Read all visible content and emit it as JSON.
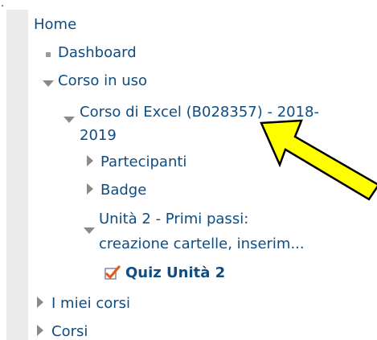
{
  "stray_mark": ".",
  "nav": {
    "home": "Home",
    "dashboard": "Dashboard",
    "current_course_section": "Corso in uso",
    "course_line1": "Corso di Excel (B028357) - 2018-",
    "course_line2": "2019",
    "participants": "Partecipanti",
    "badges": "Badge",
    "unit_line1": "Unità 2 - Primi passi:",
    "unit_line2": "creazione cartelle, inserim...",
    "quiz": "Quiz Unità 2",
    "my_courses": "I miei corsi",
    "courses": "Corsi"
  },
  "colors": {
    "link": "#0f4c81",
    "panel_border": "#ebebeb",
    "arrow_fill": "#ffff00",
    "arrow_stroke": "#000000"
  },
  "icons": {
    "dashboard": "square-bullet-icon",
    "expanded": "triangle-down-icon",
    "collapsed": "triangle-right-icon",
    "quiz": "checkbox-check-icon",
    "annotation": "yellow-arrow"
  }
}
